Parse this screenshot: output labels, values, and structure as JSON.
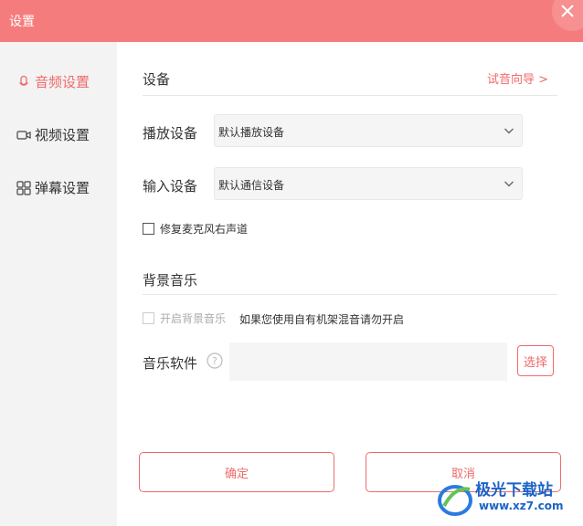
{
  "window": {
    "title": "设置"
  },
  "sidebar": {
    "items": [
      {
        "label": "音频设置",
        "icon": "microphone-icon",
        "active": true
      },
      {
        "label": "视频设置",
        "icon": "camera-icon",
        "active": false
      },
      {
        "label": "弹幕设置",
        "icon": "grid-icon",
        "active": false
      }
    ]
  },
  "device": {
    "section_title": "设备",
    "wizard_link": "试音向导 >",
    "playback_label": "播放设备",
    "playback_value": "默认播放设备",
    "input_label": "输入设备",
    "input_value": "默认通信设备",
    "fix_mic_label": "修复麦克风右声道"
  },
  "bgm": {
    "section_title": "背景音乐",
    "enable_label": "开启背景音乐",
    "note": "如果您使用自有机架混音请勿开启",
    "software_label": "音乐软件",
    "software_value": "",
    "choose_label": "选择"
  },
  "footer": {
    "ok_label": "确定",
    "cancel_label": "取消"
  },
  "watermark": {
    "text": "极光下载站",
    "url": "www.xz7.com"
  },
  "colors": {
    "accent": "#f06a6a",
    "titlebar": "#f57c7c",
    "sidebar_bg": "#f3f3f3"
  }
}
